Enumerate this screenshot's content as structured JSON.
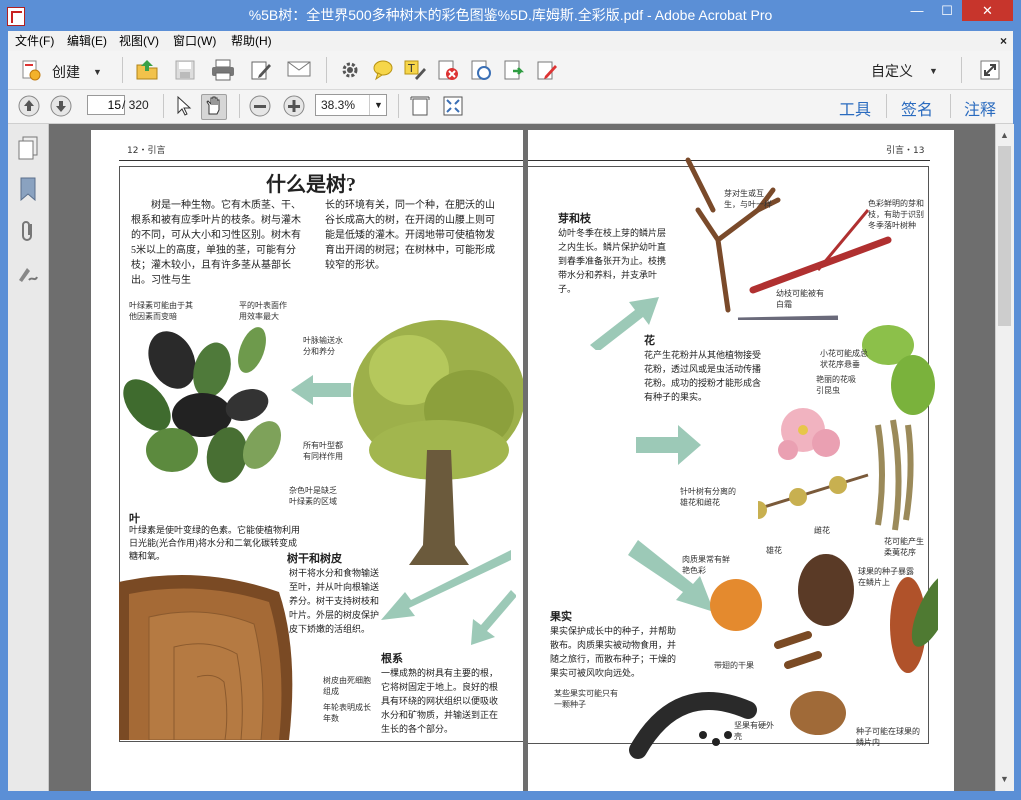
{
  "window": {
    "title": "%5B树：全世界500多种树木的彩色图鉴%5D.库姆斯.全彩版.pdf - Adobe Acrobat Pro",
    "min": "—",
    "max": "☐",
    "close": "✕"
  },
  "menu": {
    "items": [
      "文件(F)",
      "编辑(E)",
      "视图(V)",
      "窗口(W)",
      "帮助(H)"
    ],
    "close": "×"
  },
  "toolbar": {
    "create_label": "创建",
    "custom_label": "自定义"
  },
  "nav": {
    "page_value": "15",
    "page_total": "/ 320",
    "zoom_value": "38.3%",
    "tools": "工具",
    "sign": "签名",
    "comment": "注释"
  },
  "colors": {
    "accent": "#2a6bbf",
    "title_bar": "#5b8fd6",
    "close_red": "#c7352c",
    "doc_bg": "#6e6e6e",
    "arrow": "#9cc9b7"
  },
  "left_page": {
    "header": "12・引言",
    "title": "什么是树?",
    "intro_col1": "树是一种生物。它有木质茎、干、根系和被有应季叶片的枝条。树与灌木的不同，可从大小和习性区别。树木有5米以上的高度，单独的茎，可能有分枝；灌木较小，且有许多茎从基部长出。习性与生",
    "intro_col2": "长的环境有关，同一个种，在肥沃的山谷长成高大的树，在开阔的山腰上则可能是低矮的灌木。开阔地带可使植物发育出开阔的树冠；在树林中，可能形成较窄的形状。",
    "leaf_note1": "叶绿素可能由于其他因素而变暗",
    "leaf_note2": "平的叶表面作用效率最大",
    "leaf_note3": "叶脉输送水分和养分",
    "leaf_note4": "所有叶型都有同样作用",
    "leaf_note5": "杂色叶是缺乏叶绿素的区域",
    "leaf_head": "叶",
    "leaf_text": "叶绿素是使叶变绿的色素。它能使植物利用日光能(光合作用)将水分和二氧化碳转变成糖和氧。",
    "trunk_head": "树干和树皮",
    "trunk_text": "树干将水分和食物输送至叶，并从叶向根输送养分。树干支持树枝和叶片。外层的树皮保护皮下娇嫩的活组织。",
    "bark_note1": "树皮由死细胞组成",
    "bark_note2": "年轮表明成长年数",
    "root_head": "根系",
    "root_text": "一棵成熟的树具有主要的根，它将树固定于地上。良好的根具有环绕的网状组织以便吸收水分和矿物质，并输送到正在生长的各个部分。"
  },
  "right_page": {
    "header": "引言・13",
    "bud_head": "芽和枝",
    "bud_text": "幼叶冬季在枝上芽的鳞片层之内生长。鳞片保护幼叶直到春季准备张开为止。枝携带水分和养料，并支承叶子。",
    "bud_note1": "芽对生或互生，与叶一样",
    "bud_note2": "色彩鲜明的芽和枝，有助于识别冬季落叶树种",
    "bud_note3": "幼枝可能被有白霜",
    "flower_head": "花",
    "flower_text": "花产生花粉并从其他植物接受花粉，透过风或是虫活动传播花粉。成功的授粉才能形成含有种子的果实。",
    "flower_note1": "小花可能成总状花序悬垂",
    "flower_note2": "艳丽的花吸引昆虫",
    "flower_note3": "针叶树有分离的雄花和雌花",
    "flower_note4": "雌花",
    "flower_note5": "雄花",
    "flower_note6": "花可能产生柔荑花序",
    "fruit_head": "果实",
    "fruit_text": "果实保护成长中的种子，并帮助散布。肉质果实被动物食用，并随之旅行，而散布种子；干燥的果实可被风吹向远处。",
    "fruit_note1": "肉质果常有鲜艳色彩",
    "fruit_note2": "球果的种子暴露在鳞片上",
    "fruit_note3": "带翅的干果",
    "fruit_note4": "某些果实可能只有一颗种子",
    "fruit_note5": "坚果有硬外壳",
    "fruit_note6": "种子可能在球果的鳞片内"
  }
}
